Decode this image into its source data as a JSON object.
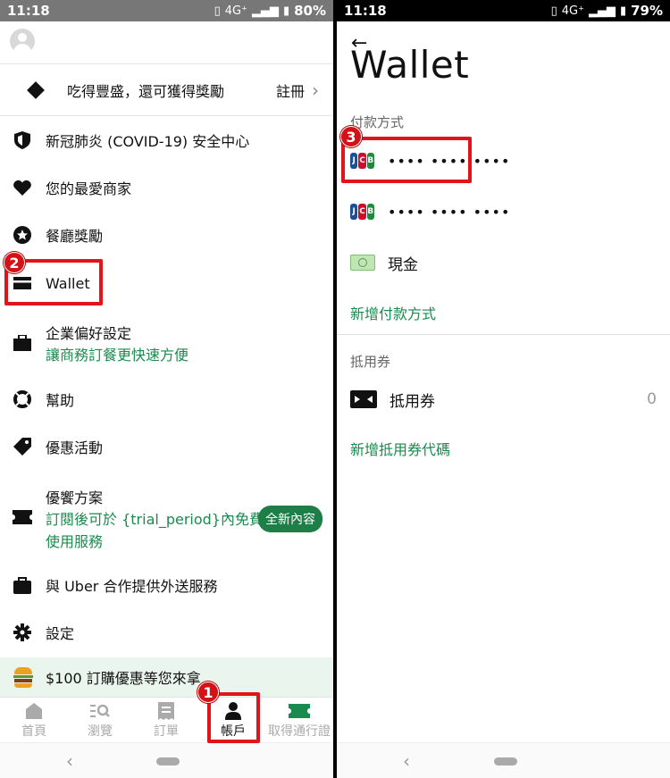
{
  "left": {
    "status": {
      "time": "11:18",
      "network": "4G⁺",
      "battery": "80%"
    },
    "promo": {
      "text": "吃得豐盛，還可獲得獎勵",
      "action": "註冊"
    },
    "menu": [
      {
        "id": "covid",
        "label": "新冠肺炎 (COVID-19) 安全中心"
      },
      {
        "id": "favorites",
        "label": "您的最愛商家"
      },
      {
        "id": "rewards",
        "label": "餐廳獎勵"
      },
      {
        "id": "wallet",
        "label": "Wallet"
      },
      {
        "id": "business",
        "label": "企業偏好設定",
        "sub": "讓商務訂餐更快速方便"
      },
      {
        "id": "help",
        "label": "幫助"
      },
      {
        "id": "promotions",
        "label": "優惠活動"
      },
      {
        "id": "eats-pass",
        "label": "優饗方案",
        "sub1": "訂閱後可於 {trial_period}內免費",
        "sub2": "使用服務",
        "badge": "全新內容"
      },
      {
        "id": "deliver",
        "label": "與 Uber 合作提供外送服務"
      },
      {
        "id": "settings",
        "label": "設定"
      }
    ],
    "promo_bottom": "$100 訂購優惠等您來拿",
    "nav": [
      {
        "id": "home",
        "label": "首頁"
      },
      {
        "id": "browse",
        "label": "瀏覽"
      },
      {
        "id": "orders",
        "label": "訂單"
      },
      {
        "id": "account",
        "label": "帳戶"
      },
      {
        "id": "pass",
        "label": "取得通行證"
      }
    ],
    "callouts": {
      "nav": "1",
      "wallet": "2"
    }
  },
  "right": {
    "status": {
      "time": "11:18",
      "network": "4G⁺",
      "battery": "79%"
    },
    "title": "Wallet",
    "payment_section": "付款方式",
    "cards": [
      {
        "brand": "JCB",
        "masked": "•••• •••• ••••"
      },
      {
        "brand": "JCB",
        "masked": "•••• •••• ••••"
      }
    ],
    "cash": "現金",
    "add_payment": "新增付款方式",
    "voucher_section": "抵用券",
    "voucher_label": "抵用券",
    "voucher_count": "0",
    "add_voucher": "新增抵用券代碼",
    "callouts": {
      "card": "3"
    }
  },
  "colors": {
    "accent_green": "#1a8a4e",
    "callout_red": "#e0141a",
    "badge_green": "#1e7e47"
  }
}
